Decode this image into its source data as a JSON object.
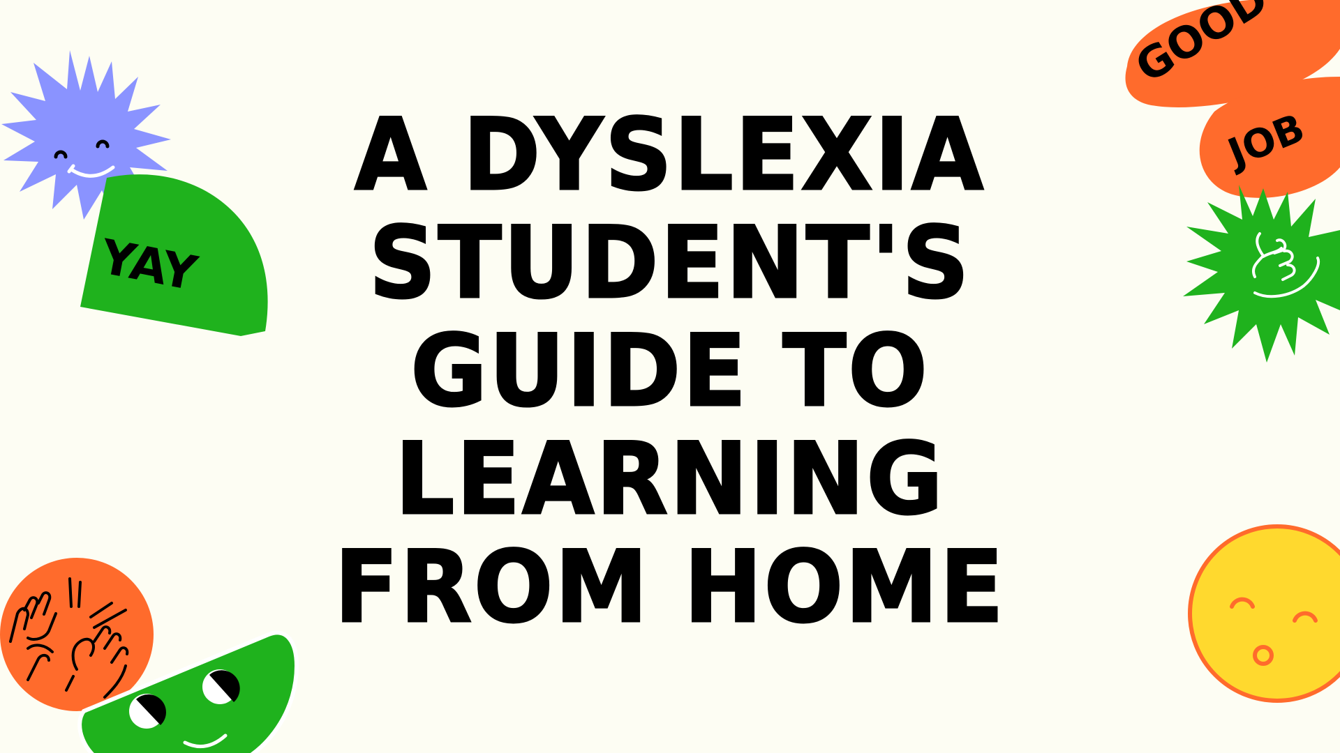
{
  "title": {
    "lines": [
      "A DYSLEXIA",
      "STUDENT'S",
      "GUIDE TO",
      "LEARNING",
      "FROM HOME"
    ]
  },
  "stickers": {
    "yay": {
      "text": "YAY",
      "color": "#1fb21d"
    },
    "good_job": {
      "good": "GOOD",
      "job": "JOB",
      "color": "#ff6b2c"
    },
    "smiley_star": {
      "color": "#8a93ff",
      "icon": "smiley-face-icon"
    },
    "thumbs_up": {
      "color": "#1fb21d",
      "icon": "thumbs-up-icon"
    },
    "hands_circle": {
      "color": "#ff6b2c",
      "icon": "waving-hands-icon"
    },
    "green_face": {
      "color": "#1fb21d",
      "icon": "winking-face-icon"
    },
    "yellow_face": {
      "color": "#ffd92e",
      "ring": "#ff6b2c",
      "icon": "happy-face-icon"
    }
  },
  "colors": {
    "background": "#fdfdf3",
    "text": "#000000"
  }
}
